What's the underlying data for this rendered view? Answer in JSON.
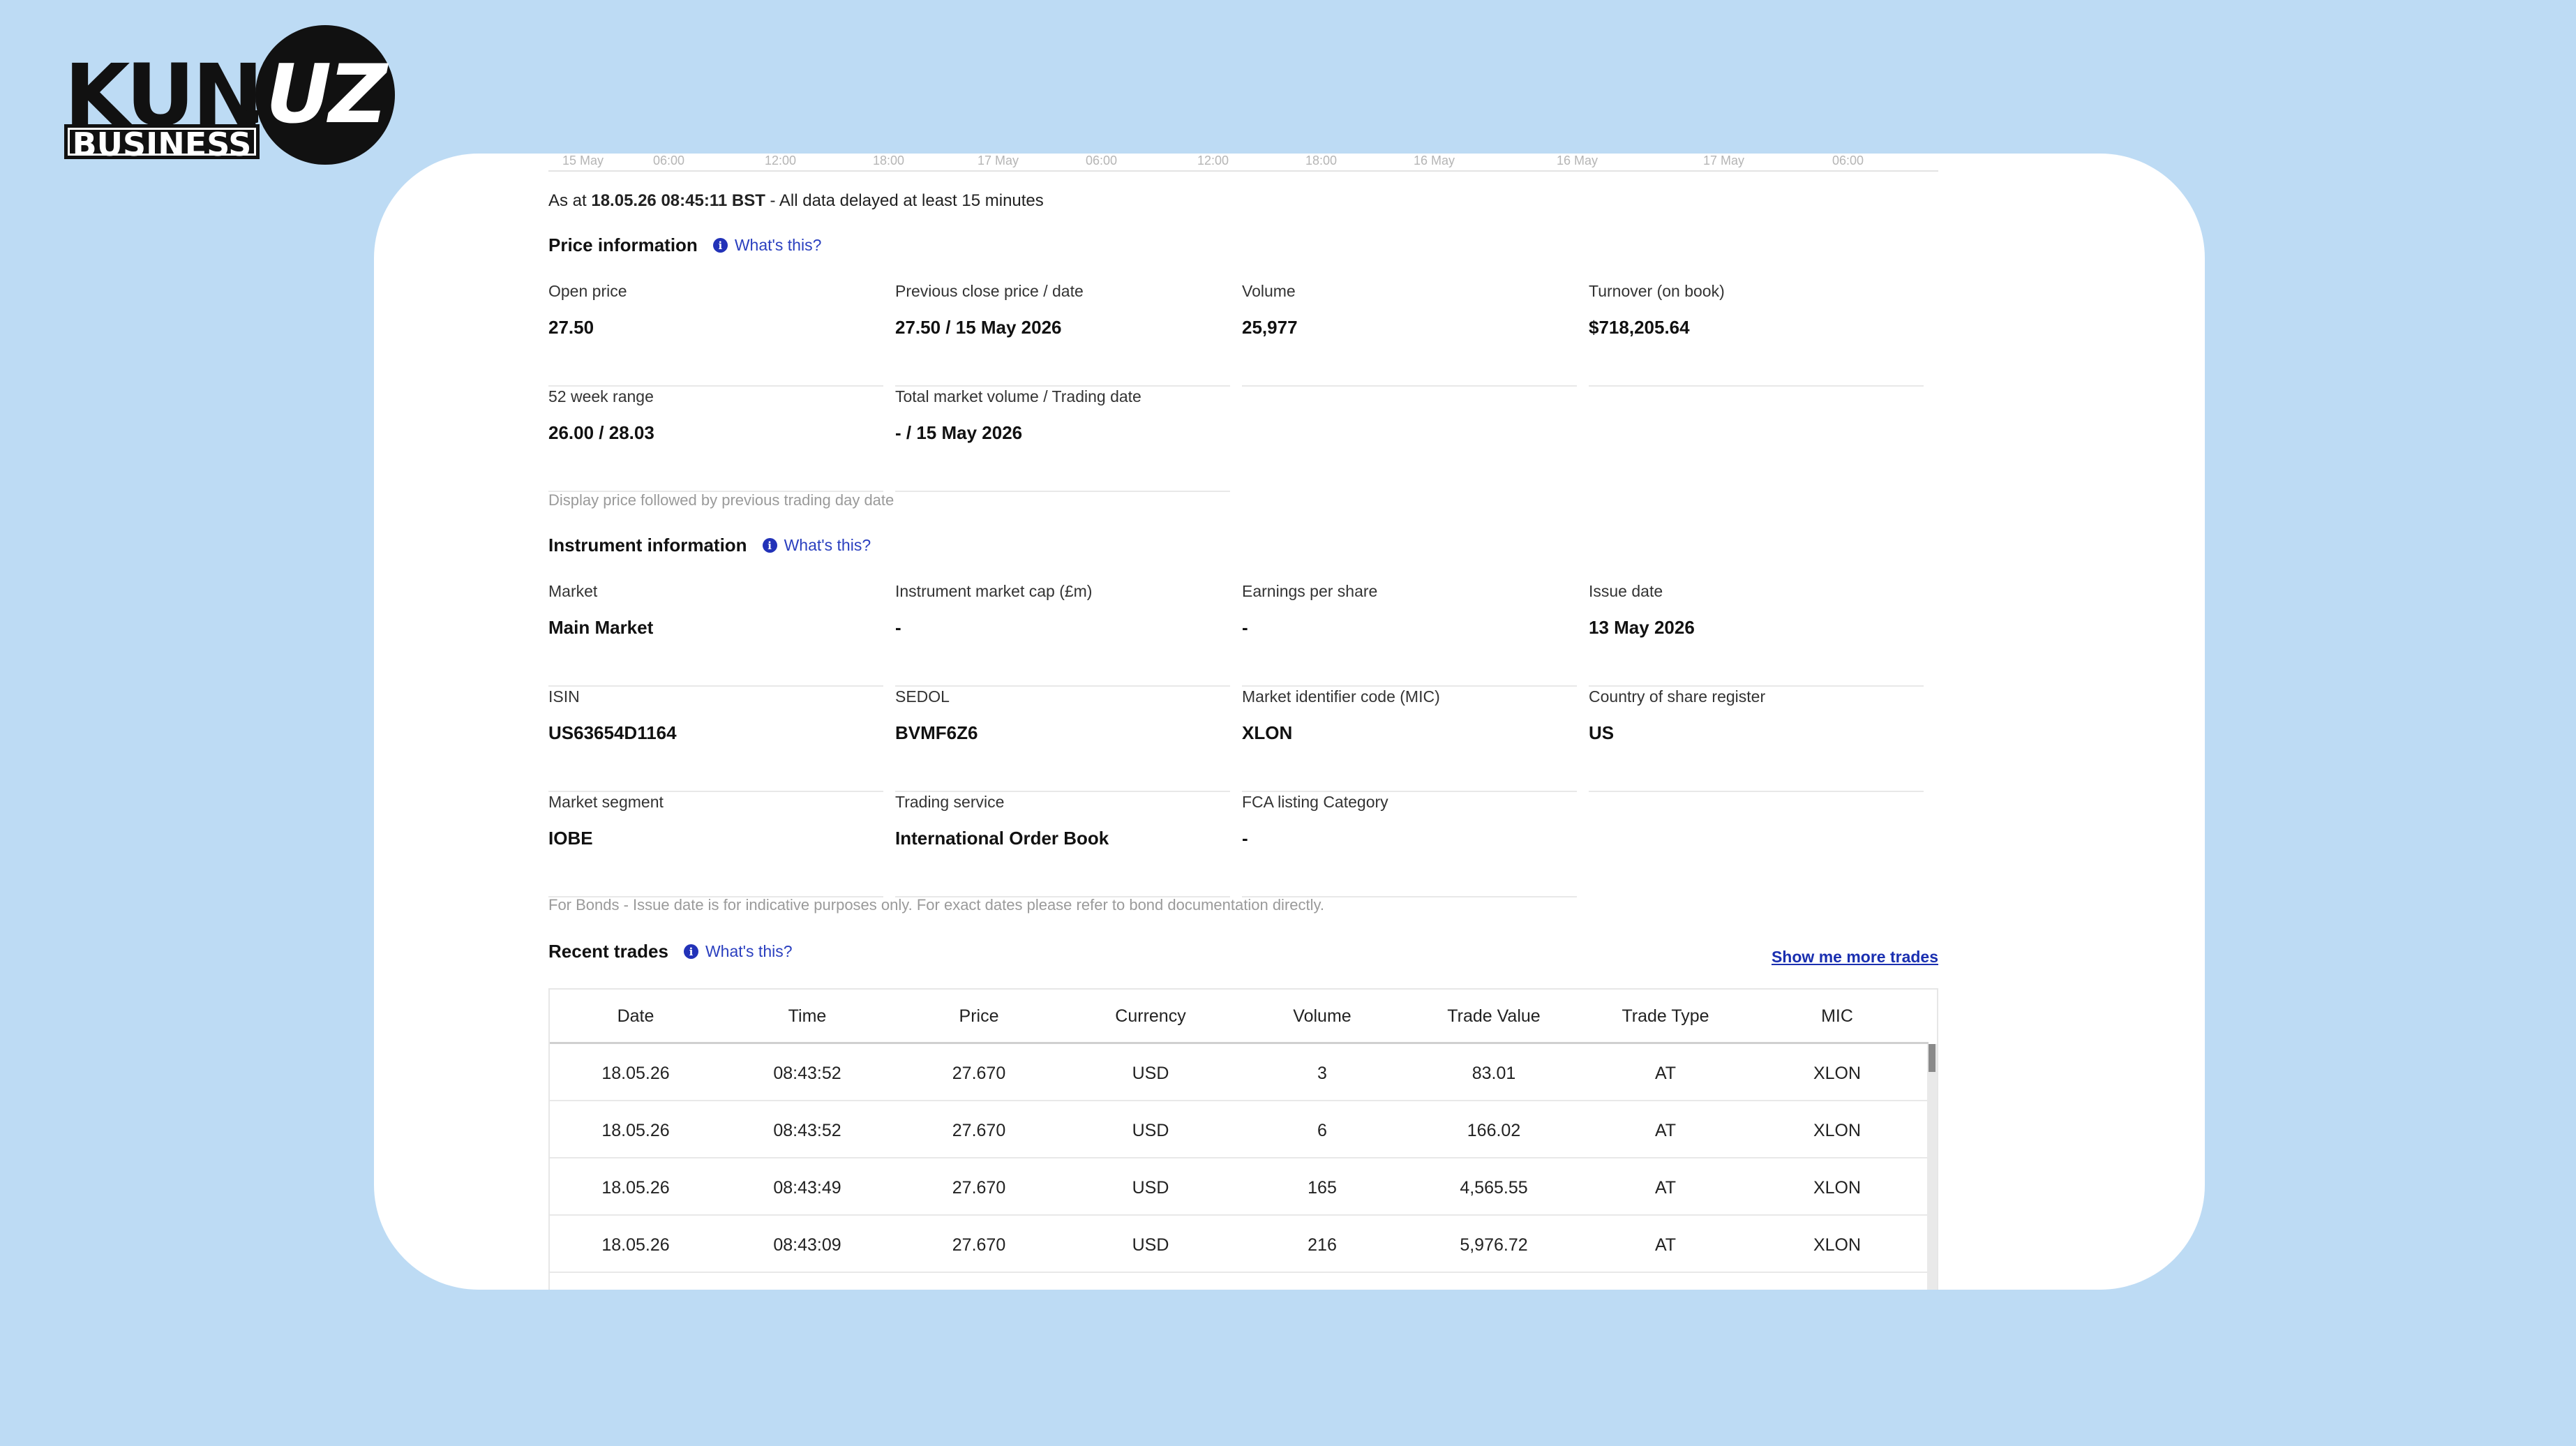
{
  "brand": {
    "kun": "KUN",
    "uz": "UZ",
    "business": "BUSINESS"
  },
  "axis_ticks": [
    "15 May",
    "06:00",
    "12:00",
    "18:00",
    "17 May",
    "06:00",
    "12:00",
    "18:00",
    "16 May",
    "16 May",
    "17 May",
    "06:00"
  ],
  "status": {
    "prefix": "As at ",
    "timestamp": "18.05.26 08:45:11 BST",
    "suffix": " - All data delayed at least 15 minutes"
  },
  "price_info": {
    "title": "Price information",
    "whats_this": "What's this?",
    "fields": [
      {
        "label": "Open price",
        "value": "27.50"
      },
      {
        "label": "Previous close price / date",
        "value": "27.50 / 15 May 2026"
      },
      {
        "label": "Volume",
        "value": "25,977"
      },
      {
        "label": "Turnover (on book)",
        "value": "$718,205.64"
      },
      {
        "label": "52 week range",
        "value": "26.00 / 28.03"
      },
      {
        "label": "Total market volume / Trading date",
        "value": "- / 15 May 2026"
      }
    ],
    "note": "Display price followed by previous trading day date"
  },
  "instrument_info": {
    "title": "Instrument information",
    "whats_this": "What's this?",
    "fields": [
      {
        "label": "Market",
        "value": "Main Market"
      },
      {
        "label": "Instrument market cap (£m)",
        "value": "-"
      },
      {
        "label": "Earnings per share",
        "value": "-"
      },
      {
        "label": "Issue date",
        "value": "13 May 2026"
      },
      {
        "label": "ISIN",
        "value": "US63654D1164"
      },
      {
        "label": "SEDOL",
        "value": "BVMF6Z6"
      },
      {
        "label": "Market identifier code (MIC)",
        "value": "XLON"
      },
      {
        "label": "Country of share register",
        "value": "US"
      },
      {
        "label": "Market segment",
        "value": "IOBE"
      },
      {
        "label": "Trading service",
        "value": "International Order Book"
      },
      {
        "label": "FCA listing Category",
        "value": "-"
      }
    ],
    "note": "For Bonds - Issue date is for indicative purposes only. For exact dates please refer to bond documentation directly."
  },
  "recent_trades": {
    "title": "Recent trades",
    "whats_this": "What's this?",
    "more_link": "Show me more trades",
    "columns": [
      "Date",
      "Time",
      "Price",
      "Currency",
      "Volume",
      "Trade Value",
      "Trade Type",
      "MIC"
    ],
    "rows": [
      [
        "18.05.26",
        "08:43:52",
        "27.670",
        "USD",
        "3",
        "83.01",
        "AT",
        "XLON"
      ],
      [
        "18.05.26",
        "08:43:52",
        "27.670",
        "USD",
        "6",
        "166.02",
        "AT",
        "XLON"
      ],
      [
        "18.05.26",
        "08:43:49",
        "27.670",
        "USD",
        "165",
        "4,565.55",
        "AT",
        "XLON"
      ],
      [
        "18.05.26",
        "08:43:09",
        "27.670",
        "USD",
        "216",
        "5,976.72",
        "AT",
        "XLON"
      ]
    ]
  }
}
